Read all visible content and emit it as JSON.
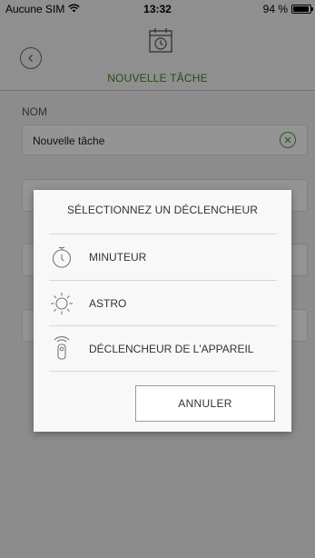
{
  "status_bar": {
    "carrier": "Aucune SIM",
    "wifi_icon": "wifi-icon",
    "time": "13:32",
    "battery": "94 %",
    "battery_level": 0.94
  },
  "nav": {
    "back_icon": "chevron-left-icon",
    "header_icon": "calendar-clock-icon",
    "title": "NOUVELLE TÂCHE"
  },
  "form": {
    "name_label": "NOM",
    "name_value": "Nouvelle tâche",
    "clear_icon": "clear-icon"
  },
  "dialog": {
    "title": "SÉLECTIONNEZ UN DÉCLENCHEUR",
    "options": [
      {
        "label": "MINUTEUR",
        "icon": "timer-icon"
      },
      {
        "label": "ASTRO",
        "icon": "sun-icon"
      },
      {
        "label": "DÉCLENCHEUR DE L'APPAREIL",
        "icon": "remote-control-icon"
      }
    ],
    "cancel_label": "ANNULER"
  },
  "colors": {
    "accent_green": "#3b8a22",
    "overlay": "rgba(0,0,0,0.42)",
    "dialog_bg": "#f8f8f8"
  }
}
